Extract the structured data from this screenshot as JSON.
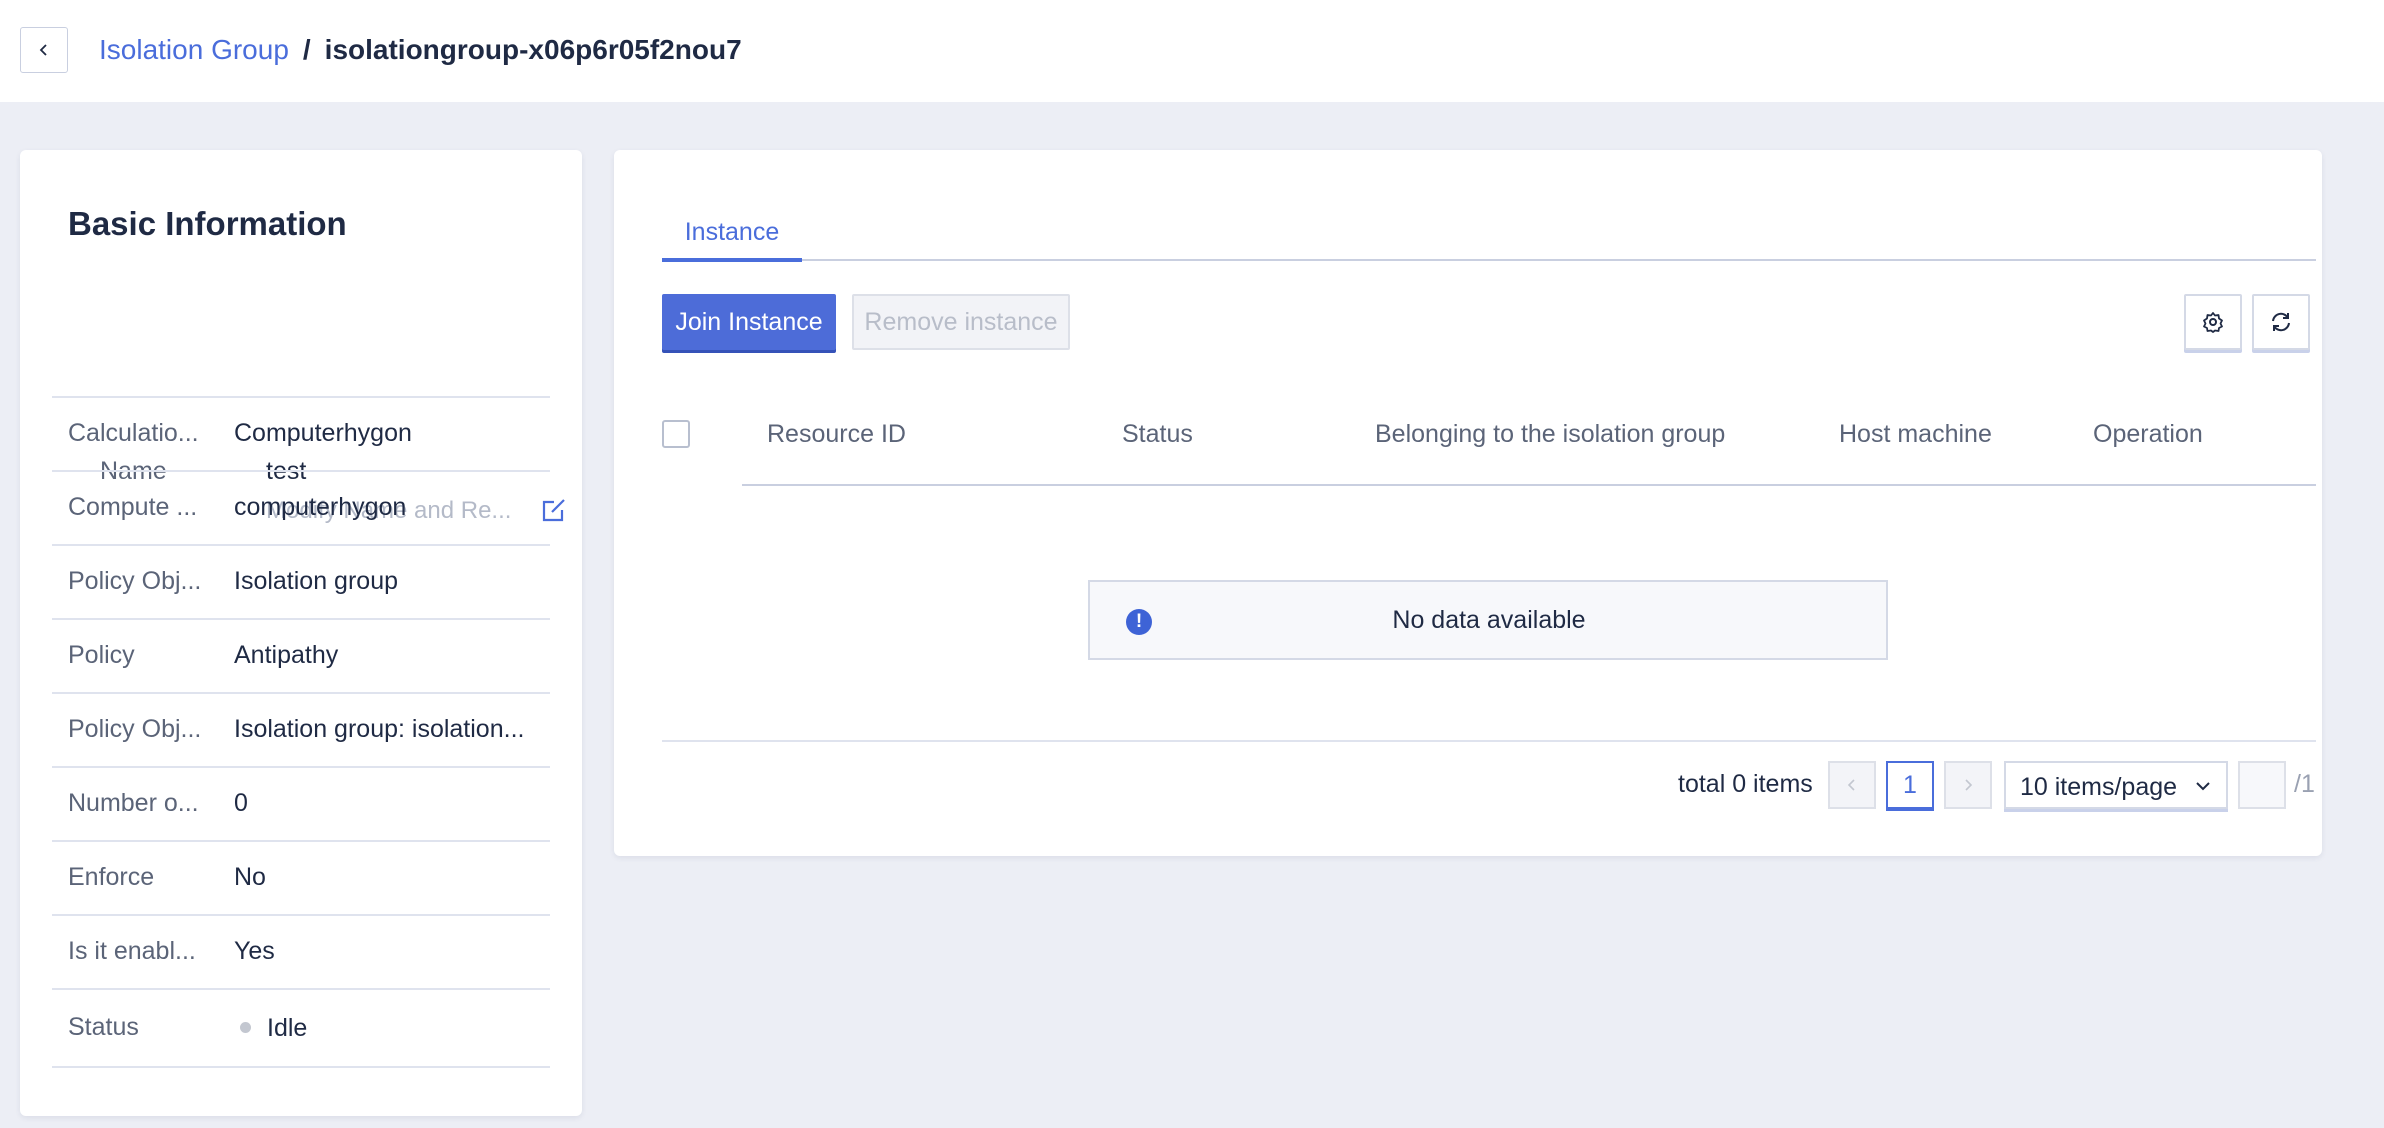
{
  "header": {
    "breadcrumb_parent": "Isolation Group",
    "breadcrumb_separator": "/",
    "breadcrumb_current": "isolationgroup-x06p6r05f2nou7"
  },
  "basic_info": {
    "title": "Basic Information",
    "name_label": "Name",
    "name_value": "test",
    "name_hint": "Modify Name and Re...",
    "rows": [
      {
        "label": "Calculatio...",
        "value": "Computerhygon"
      },
      {
        "label": "Compute ...",
        "value": "computerhygon"
      },
      {
        "label": "Policy Obj...",
        "value": "Isolation group"
      },
      {
        "label": "Policy",
        "value": "Antipathy"
      },
      {
        "label": "Policy Obj...",
        "value": "Isolation group: isolation..."
      },
      {
        "label": "Number o...",
        "value": "0"
      },
      {
        "label": "Enforce",
        "value": "No"
      },
      {
        "label": "Is it enabl...",
        "value": "Yes"
      }
    ],
    "status_label": "Status",
    "status_value": "Idle"
  },
  "main": {
    "tab_label": "Instance",
    "join_button": "Join Instance",
    "remove_button": "Remove instance",
    "columns": [
      "Resource ID",
      "Status",
      "Belonging to the isolation group",
      "Host machine",
      "Operation"
    ],
    "empty_text": "No data available",
    "empty_icon": "!",
    "pagination": {
      "total": "total 0 items",
      "current_page": "1",
      "page_size": "10 items/page",
      "total_pages": "/1"
    }
  }
}
